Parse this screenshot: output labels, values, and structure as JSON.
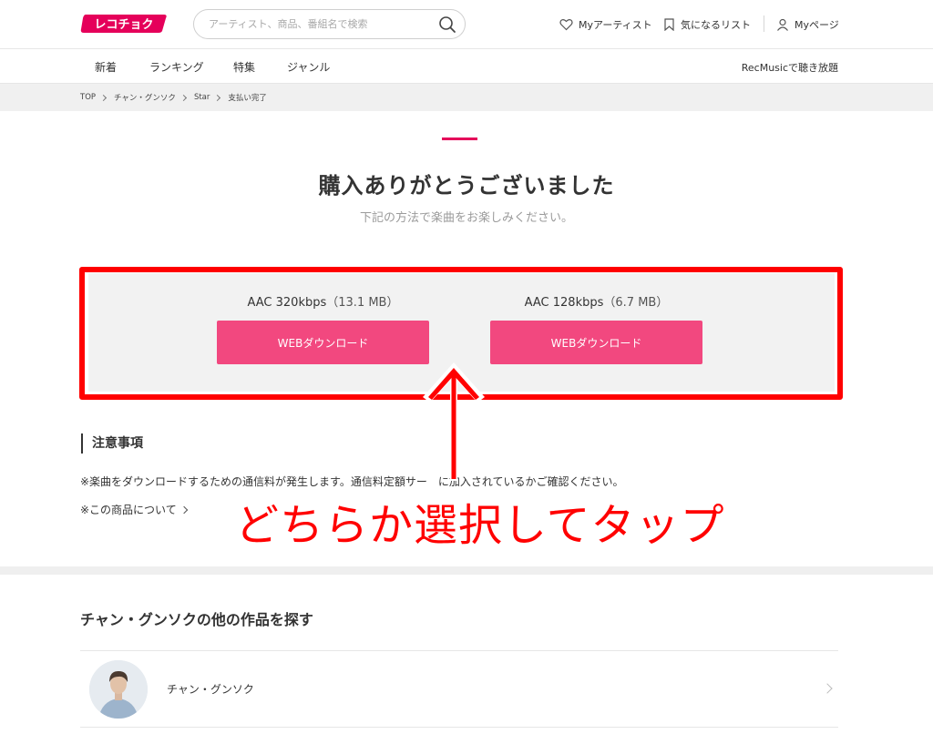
{
  "header": {
    "logo_text": "レコチョク",
    "search_placeholder": "アーティスト、商品、番組名で検索",
    "my_artist": "Myアーティスト",
    "wishlist": "気になるリスト",
    "mypage": "Myページ"
  },
  "subnav": {
    "items": [
      "新着",
      "ランキング",
      "特集",
      "ジャンル"
    ],
    "recmusic": "RecMusicで聴き放題"
  },
  "breadcrumb": [
    "TOP",
    "チャン・グンソク",
    "Star",
    "支払い完了"
  ],
  "main": {
    "title": "購入ありがとうございました",
    "subtitle": "下記の方法で楽曲をお楽しみください。",
    "formats": [
      {
        "label": "AAC 320kbps",
        "size": "（13.1 MB）",
        "button": "WEBダウンロード"
      },
      {
        "label": "AAC 128kbps",
        "size": "（6.7 MB）",
        "button": "WEBダウンロード"
      }
    ],
    "notes_heading": "注意事項",
    "note_1": "※楽曲をダウンロードするための通信料が発生します。通信料定額サー　に加入されているかご確認ください。",
    "note_2": "※この商品について"
  },
  "annotation": {
    "text": "どちらか選択してタップ",
    "color": "#ff0000"
  },
  "related": {
    "title": "チャン・グンソクの他の作品を探す",
    "artist_name": "チャン・グンソク"
  },
  "colors": {
    "brand": "#e5005a",
    "button": "#f2487f",
    "annotation": "#ff0000"
  }
}
